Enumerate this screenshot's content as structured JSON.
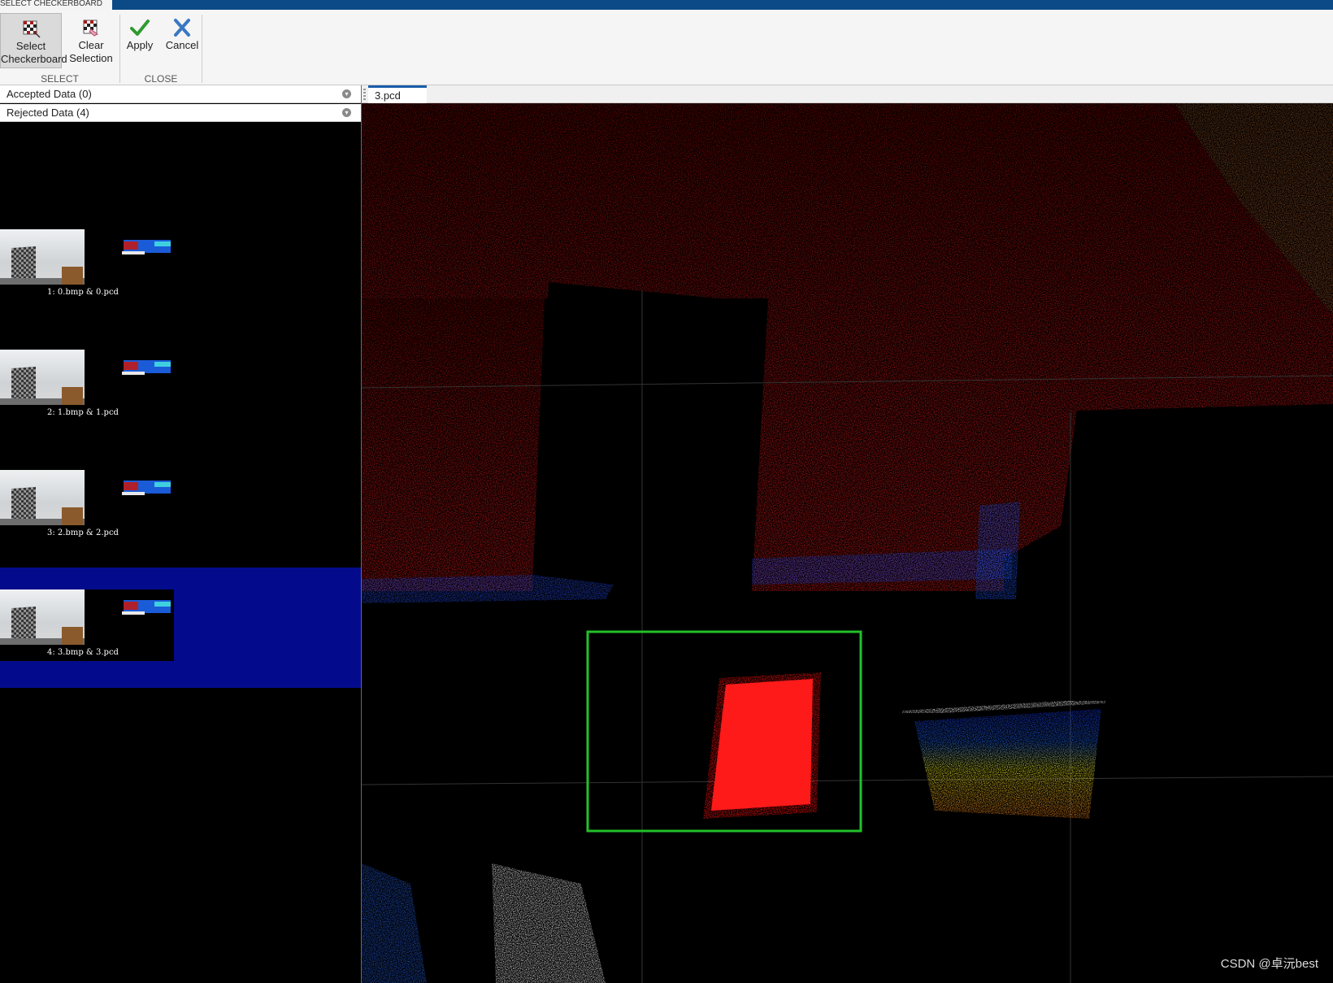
{
  "window": {
    "active_tab": "SELECT CHECKERBOARD"
  },
  "toolstrip": {
    "select_group": {
      "title": "SELECT",
      "select_button": {
        "line1": "Select",
        "line2": "Checkerboard",
        "icon": "checkerboard-select-icon"
      },
      "clear_button": {
        "line1": "Clear",
        "line2": "Selection",
        "icon": "checkerboard-clear-icon"
      }
    },
    "close_group": {
      "title": "CLOSE",
      "apply_button": {
        "label": "Apply",
        "icon": "green-check-icon"
      },
      "cancel_button": {
        "label": "Cancel",
        "icon": "blue-x-icon"
      }
    }
  },
  "data_browser": {
    "accepted": {
      "label": "Accepted Data (0)"
    },
    "rejected": {
      "label": "Rejected Data (4)"
    },
    "items": [
      {
        "caption": "1: 0.bmp & 0.pcd",
        "selected": false
      },
      {
        "caption": "2: 1.bmp & 1.pcd",
        "selected": false
      },
      {
        "caption": "3: 2.bmp & 2.pcd",
        "selected": false
      },
      {
        "caption": "4: 3.bmp & 3.pcd",
        "selected": true
      }
    ],
    "selected_color": "#030b8c"
  },
  "viewer": {
    "tab_label": "3.pcd",
    "roi_color": "#22c02a"
  },
  "watermark": "CSDN @卓沅best"
}
